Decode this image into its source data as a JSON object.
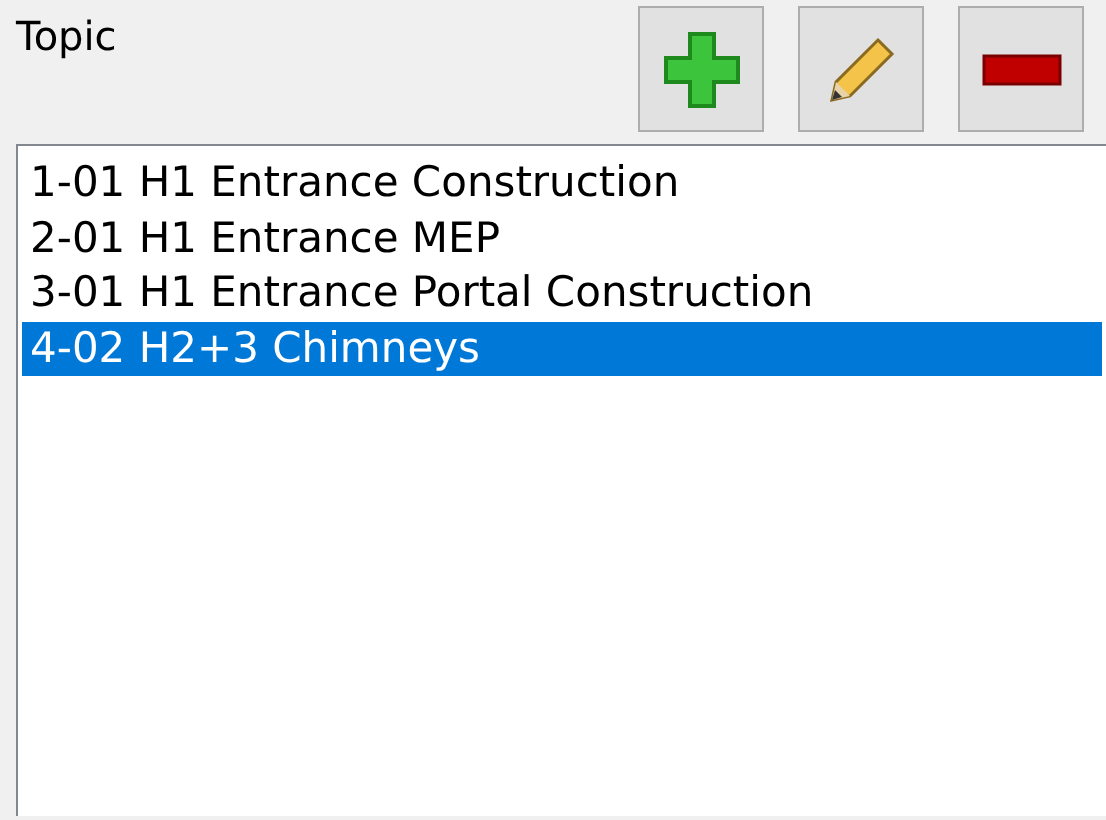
{
  "label": "Topic",
  "toolbar": [
    {
      "kind": "add"
    },
    {
      "kind": "edit"
    },
    {
      "kind": "remove"
    }
  ],
  "list": [
    {
      "text": "1-01 H1 Entrance Construction",
      "selected": false
    },
    {
      "text": "2-01 H1 Entrance MEP",
      "selected": false
    },
    {
      "text": "3-01 H1 Entrance Portal Construction",
      "selected": false
    },
    {
      "text": "4-02 H2+3 Chimneys",
      "selected": true
    }
  ]
}
